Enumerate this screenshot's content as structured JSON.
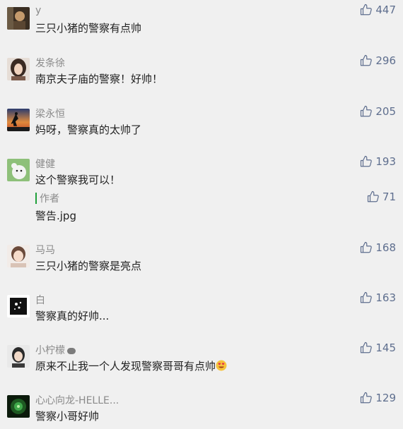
{
  "comments": [
    {
      "nickname": "y",
      "text": "三只小猪的警察有点帅",
      "likes": "447",
      "avatar": "avatar-icon"
    },
    {
      "nickname": "发条徐",
      "text": "南京夫子庙的警察！好帅！",
      "likes": "296",
      "avatar": "avatar-icon"
    },
    {
      "nickname": "梁永恒",
      "text": "妈呀，警察真的太帅了",
      "likes": "205",
      "avatar": "avatar-icon"
    },
    {
      "nickname": "健健",
      "text": "这个警察我可以！",
      "likes": "193",
      "avatar": "avatar-icon",
      "reply": {
        "author": "作者",
        "text": "警告.jpg",
        "likes": "71"
      }
    },
    {
      "nickname": "马马",
      "text": "三只小猪的警察是亮点",
      "likes": "168",
      "avatar": "avatar-icon"
    },
    {
      "nickname": "白",
      "text": "警察真的好帅...",
      "likes": "163",
      "avatar": "avatar-icon"
    },
    {
      "nickname": "小柠檬",
      "text": "原来不止我一个人发现警察哥哥有点帅",
      "likes": "145",
      "avatar": "avatar-icon",
      "emoji": "smiling-face-with-heart-eyes-icon"
    },
    {
      "nickname": "心心向龙-HELLE...",
      "text": "警察小哥好帅",
      "likes": "129",
      "avatar": "avatar-icon"
    }
  ],
  "colors": {
    "background": "#f0f0f0",
    "nickname": "#8a8a8a",
    "like": "#5e6e8e",
    "reply_bar": "#1fa03a"
  }
}
